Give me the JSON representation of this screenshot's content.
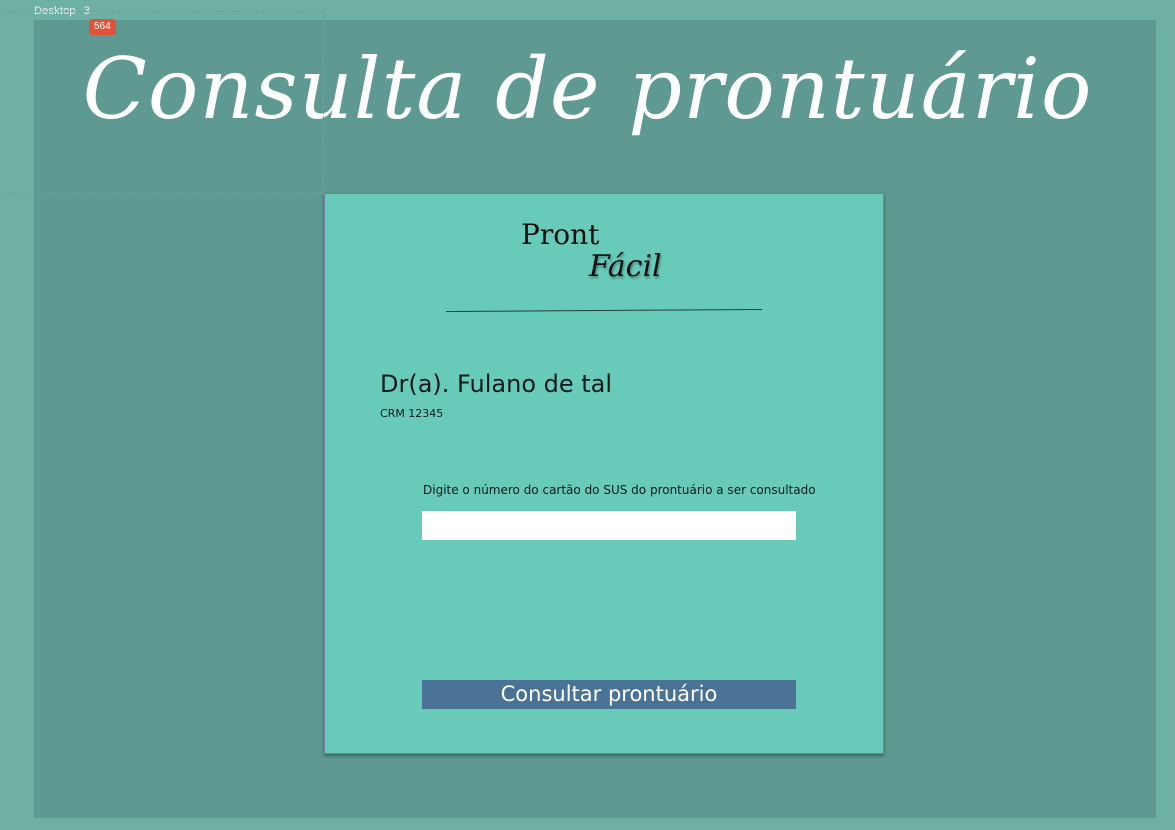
{
  "canvas": {
    "frame_label": "Desktop",
    "frame_number": "3",
    "selection_badge": "564"
  },
  "page": {
    "title": "Consulta de prontuário"
  },
  "logo": {
    "part1": "Pront",
    "part2": "Fácil"
  },
  "doctor": {
    "name": "Dr(a). Fulano de tal",
    "crm": "CRM 12345"
  },
  "form": {
    "instruction": "Digite o número do cartão do SUS do prontuário a ser consultado",
    "sus_value": "",
    "submit_label": "Consultar prontuário"
  },
  "colors": {
    "canvas_bg": "#6fb0a4",
    "frame_bg": "#5e9a91",
    "card_bg": "#68cbb9",
    "button_bg": "#4a7295",
    "badge": "#e0533a"
  }
}
